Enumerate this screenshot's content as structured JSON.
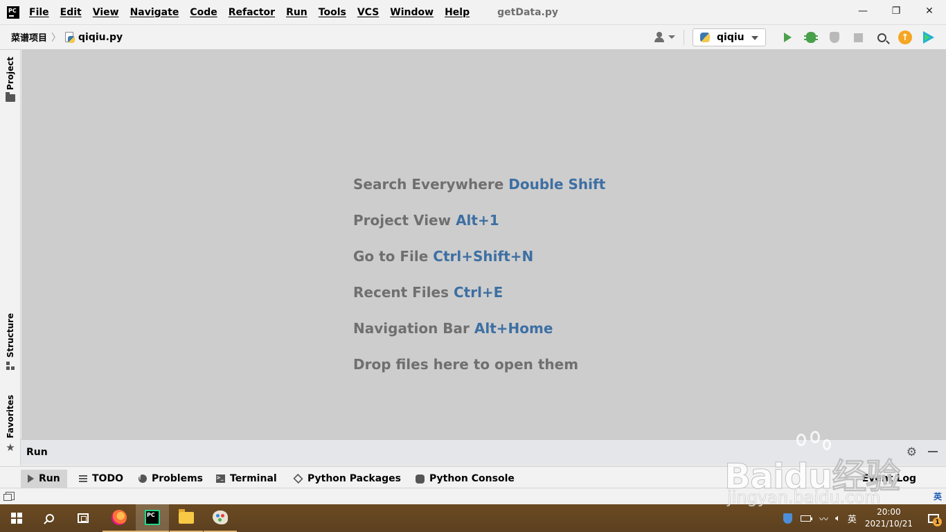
{
  "app": {
    "logo_text": "PC",
    "menu": [
      "File",
      "Edit",
      "View",
      "Navigate",
      "Code",
      "Refactor",
      "Run",
      "Tools",
      "VCS",
      "Window",
      "Help"
    ],
    "window_title": "getData.py",
    "window_controls": {
      "minimize": "—",
      "restore": "❐",
      "close": "✕"
    }
  },
  "navbar": {
    "project": "菜谱项目",
    "file": "qiqiu.py",
    "run_config": "qiqiu"
  },
  "left_tools": {
    "project": "Project",
    "structure": "Structure",
    "favorites": "Favorites"
  },
  "editor": {
    "hints": [
      {
        "text": "Search Everywhere",
        "key": "Double Shift"
      },
      {
        "text": "Project View",
        "key": "Alt+1"
      },
      {
        "text": "Go to File",
        "key": "Ctrl+Shift+N"
      },
      {
        "text": "Recent Files",
        "key": "Ctrl+E"
      },
      {
        "text": "Navigation Bar",
        "key": "Alt+Home"
      },
      {
        "text": "Drop files here to open them",
        "key": ""
      }
    ],
    "hint_color": "#6f6f6f",
    "key_color": "#3d6fa3"
  },
  "run_panel": {
    "title": "Run"
  },
  "bottom_tabs": {
    "run": "Run",
    "todo": "TODO",
    "problems": "Problems",
    "terminal": "Terminal",
    "python_packages": "Python Packages",
    "python_console": "Python Console",
    "event_log": "Event Log"
  },
  "status_bar": {
    "ime": "英"
  },
  "taskbar": {
    "ime": "英",
    "time": "20:00",
    "date": "2021/10/21",
    "notifications": "1"
  },
  "watermark": {
    "main": "Baidu经验",
    "sub": "jingyan.baidu.com"
  }
}
